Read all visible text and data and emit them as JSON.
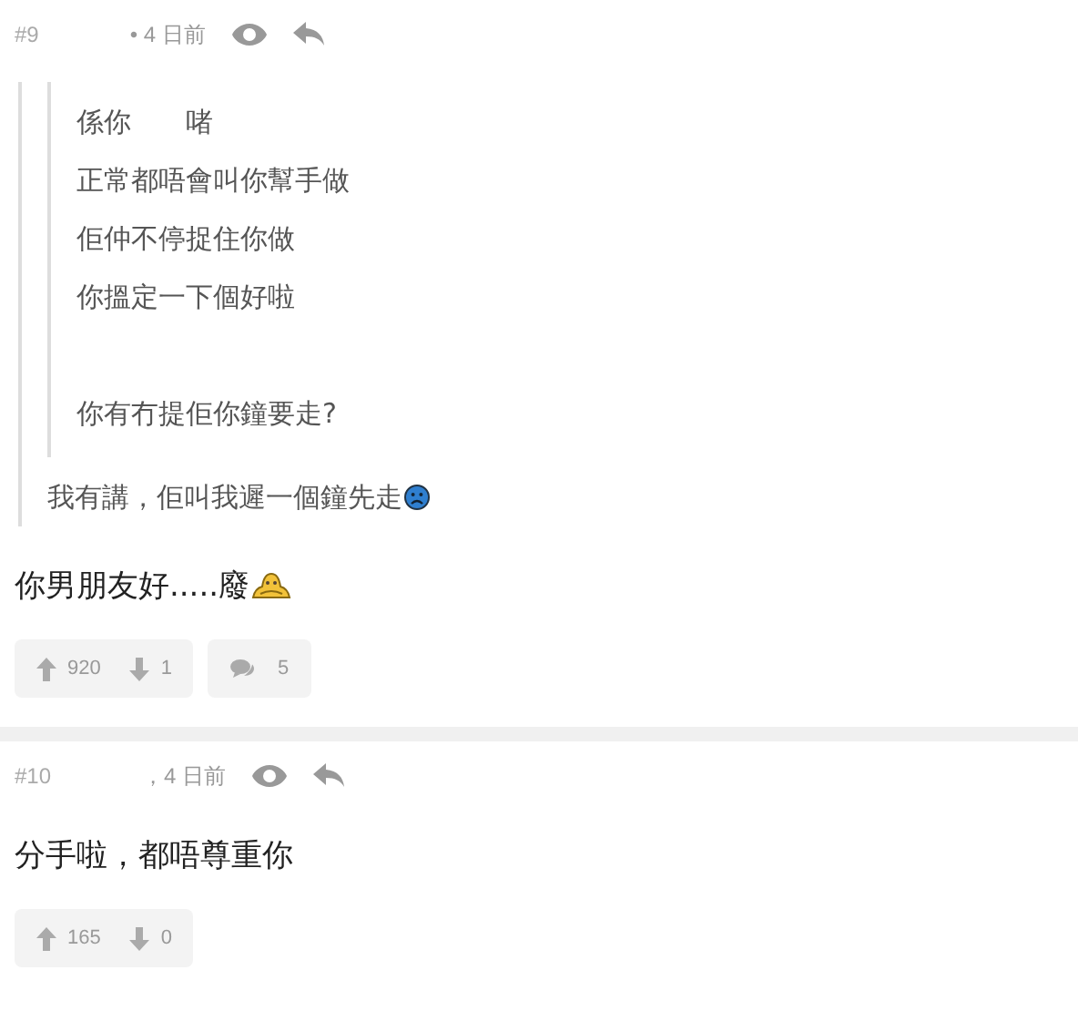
{
  "posts": [
    {
      "number": "#9",
      "time": "• 4 日前",
      "quote": {
        "inner": {
          "paragraphs": [
            [
              [
                {
                  "kind": "text",
                  "text": "係你"
                },
                {
                  "kind": "gap"
                },
                {
                  "kind": "text",
                  "text": "啫"
                }
              ],
              [
                {
                  "kind": "text",
                  "text": "正常都唔會叫你幫手做"
                }
              ],
              [
                {
                  "kind": "text",
                  "text": "佢仲不停捉住你做"
                }
              ],
              [
                {
                  "kind": "text",
                  "text": "你搵定一下個好啦"
                }
              ]
            ],
            [
              [
                {
                  "kind": "text",
                  "text": "你有冇提佢你鐘要走?"
                }
              ]
            ]
          ]
        },
        "lines": [
          [
            {
              "kind": "text",
              "text": "我有講，佢叫我遲一個鐘先走"
            },
            {
              "kind": "sad"
            }
          ]
        ]
      },
      "body": [
        [
          {
            "kind": "text",
            "text": "你男朋友好.....廢"
          },
          {
            "kind": "grin"
          }
        ]
      ],
      "votes": {
        "up": "920",
        "down": "1"
      },
      "replies": "5"
    },
    {
      "number": "#10",
      "time": "，4 日前",
      "body": [
        [
          {
            "kind": "text",
            "text": "分手啦，都唔尊重你"
          }
        ]
      ],
      "votes": {
        "up": "165",
        "down": "0"
      }
    }
  ]
}
